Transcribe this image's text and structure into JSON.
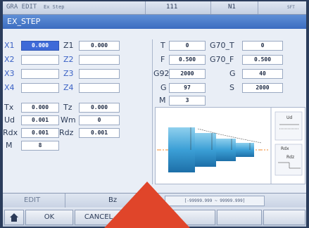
{
  "status": {
    "mode": "GRA EDIT",
    "file": "Ex Step",
    "prog": "111",
    "block": "N1",
    "right": "SFT"
  },
  "title": "EX_STEP",
  "left_fields": [
    {
      "label": "X1",
      "value": "0.000",
      "active": true
    },
    {
      "label": "Z1",
      "value": "0.000"
    },
    {
      "label": "X2",
      "value": ""
    },
    {
      "label": "Z2",
      "value": ""
    },
    {
      "label": "X3",
      "value": ""
    },
    {
      "label": "Z3",
      "value": ""
    },
    {
      "label": "X4",
      "value": ""
    },
    {
      "label": "Z4",
      "value": ""
    },
    {
      "label": "Tx",
      "value": "0.000"
    },
    {
      "label": "Tz",
      "value": "0.000"
    },
    {
      "label": "Ud",
      "value": "0.001"
    },
    {
      "label": "Wm",
      "value": "0"
    },
    {
      "label": "Rdx",
      "value": "0.001"
    },
    {
      "label": "Rdz",
      "value": "0.001"
    },
    {
      "label": "M",
      "value": "8"
    }
  ],
  "right_fields": [
    {
      "label": "T",
      "value": "0"
    },
    {
      "label": "G70_T",
      "value": "0"
    },
    {
      "label": "F",
      "value": "0.500"
    },
    {
      "label": "G70_F",
      "value": "0.500"
    },
    {
      "label": "G92",
      "value": "2000"
    },
    {
      "label": "G",
      "value": "40"
    },
    {
      "label": "G",
      "value": "97"
    },
    {
      "label": "S",
      "value": "2000"
    },
    {
      "label": "M",
      "value": "3"
    }
  ],
  "diagram_labels": {
    "ud": "Ud",
    "rdx": "Rdx",
    "rdz": "Rdz"
  },
  "bottom": {
    "mode": "EDIT",
    "field_label": "Bz",
    "range": "[-99999.999 ~ 99999.999]"
  },
  "softkeys": {
    "ok": "OK",
    "cancel": "CANCEL"
  },
  "colors": {
    "title_bar": "#3b6cc0",
    "active_field": "#3e6ad8",
    "arrow": "#e0452a"
  }
}
